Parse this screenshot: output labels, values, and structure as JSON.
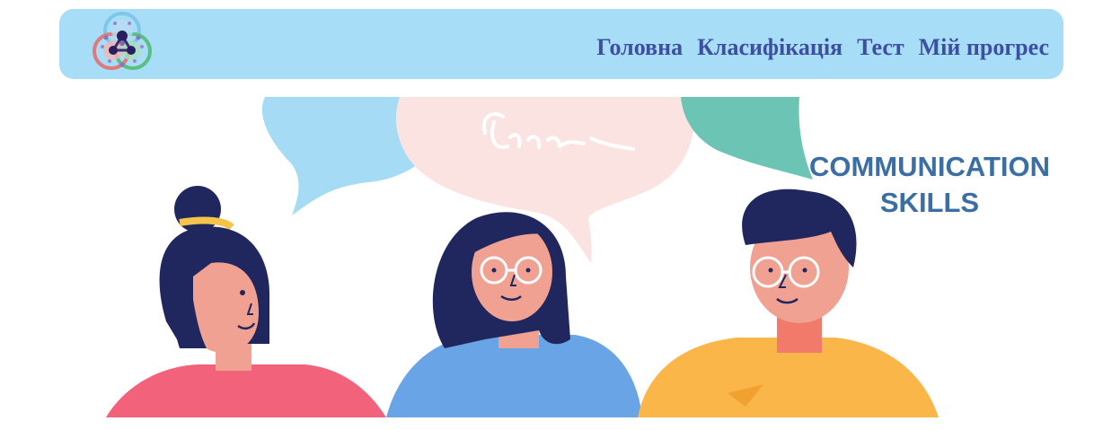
{
  "logo": {
    "icon": "molecule-network-logo"
  },
  "nav": {
    "items": [
      {
        "label": "Головна"
      },
      {
        "label": "Класифікація"
      },
      {
        "label": "Тест"
      },
      {
        "label": "Мій прогрес"
      }
    ]
  },
  "hero": {
    "title_line1": "COMMUNICATION",
    "title_line2": "SKILLS",
    "illustration": "three-people-talking-with-speech-bubbles"
  },
  "colors": {
    "navbar_bg": "#a8ddf7",
    "nav_text": "#3c4fa0",
    "title_text": "#3a6ea5"
  }
}
